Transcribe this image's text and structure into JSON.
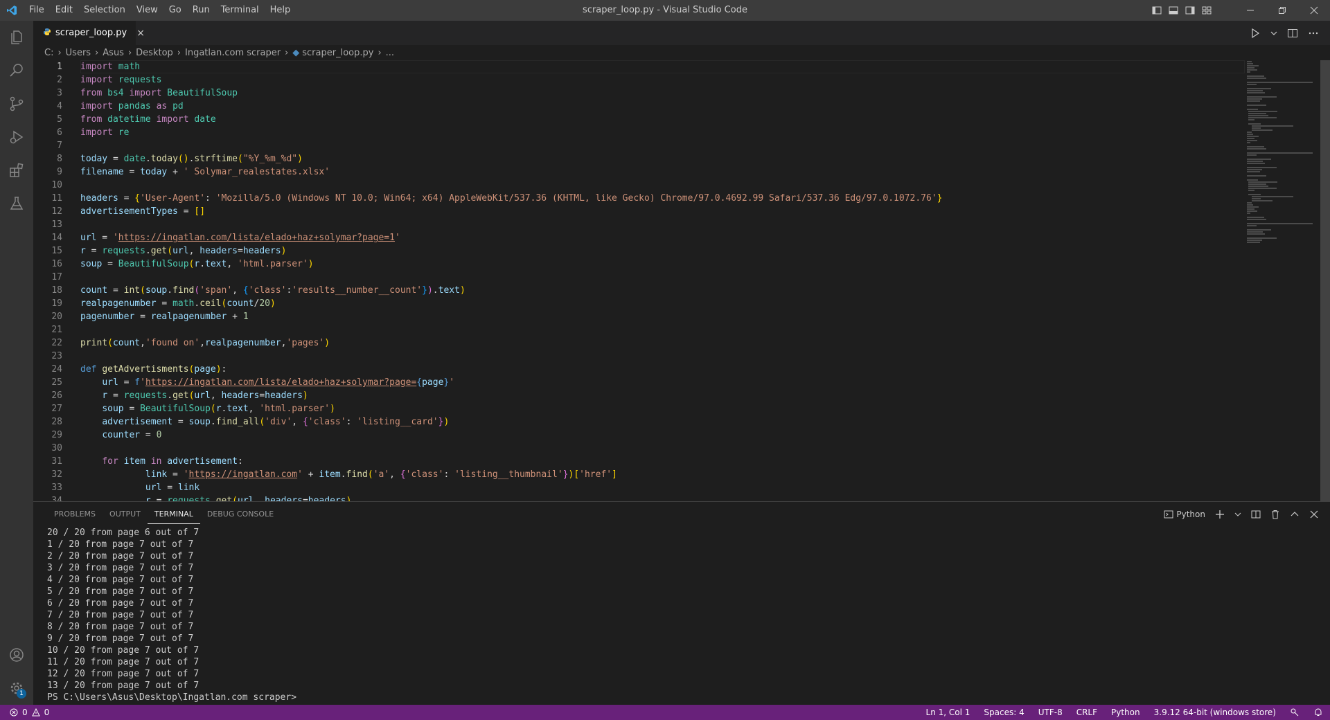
{
  "window": {
    "title": "scraper_loop.py - Visual Studio Code",
    "menu": [
      "File",
      "Edit",
      "Selection",
      "View",
      "Go",
      "Run",
      "Terminal",
      "Help"
    ]
  },
  "tab": {
    "label": "scraper_loop.py",
    "close_glyph": "×"
  },
  "breadcrumb": [
    "C:",
    "Users",
    "Asus",
    "Desktop",
    "Ingatlan.com scraper",
    "scraper_loop.py",
    "..."
  ],
  "code_lines": [
    "import math",
    "import requests",
    "from bs4 import BeautifulSoup",
    "import pandas as pd",
    "from datetime import date",
    "import re",
    "",
    "today = date.today().strftime(\"%Y_%m_%d\")",
    "filename = today + ' Solymar_realestates.xlsx'",
    "",
    "headers = {'User-Agent': 'Mozilla/5.0 (Windows NT 10.0; Win64; x64) AppleWebKit/537.36 (KHTML, like Gecko) Chrome/97.0.4692.99 Safari/537.36 Edg/97.0.1072.76'}",
    "advertisementTypes = []",
    "",
    "url = 'https://ingatlan.com/lista/elado+haz+solymar?page=1'",
    "r = requests.get(url, headers=headers)",
    "soup = BeautifulSoup(r.text, 'html.parser')",
    "",
    "count = int(soup.find('span', {'class':'results__number__count'}).text)",
    "realpagenumber = math.ceil(count/20)",
    "pagenumber = realpagenumber + 1",
    "",
    "print(count,'found on',realpagenumber,'pages')",
    "",
    "def getAdvertisments(page):",
    "    url = f'https://ingatlan.com/lista/elado+haz+solymar?page={page}'",
    "    r = requests.get(url, headers=headers)",
    "    soup = BeautifulSoup(r.text, 'html.parser')",
    "    advertisement = soup.find_all('div', {'class': 'listing__card'})",
    "    counter = 0",
    "",
    "    for item in advertisement:",
    "            link = 'https://ingatlan.com' + item.find('a', {'class': 'listing__thumbnail'})['href']",
    "            url = link",
    "            r = requests.get(url, headers=headers)"
  ],
  "panel": {
    "tabs": [
      "PROBLEMS",
      "OUTPUT",
      "TERMINAL",
      "DEBUG CONSOLE"
    ],
    "active_tab": "TERMINAL",
    "shell_label": "Python",
    "terminal_lines": [
      "20 / 20 from page 6 out of 7",
      "1 / 20 from page 7 out of 7",
      "2 / 20 from page 7 out of 7",
      "3 / 20 from page 7 out of 7",
      "4 / 20 from page 7 out of 7",
      "5 / 20 from page 7 out of 7",
      "6 / 20 from page 7 out of 7",
      "7 / 20 from page 7 out of 7",
      "8 / 20 from page 7 out of 7",
      "9 / 20 from page 7 out of 7",
      "10 / 20 from page 7 out of 7",
      "11 / 20 from page 7 out of 7",
      "12 / 20 from page 7 out of 7",
      "13 / 20 from page 7 out of 7",
      "PS C:\\Users\\Asus\\Desktop\\Ingatlan.com scraper>"
    ]
  },
  "statusbar": {
    "errors": "0",
    "warnings": "0",
    "position": "Ln 1, Col 1",
    "spaces": "Spaces: 4",
    "encoding": "UTF-8",
    "eol": "CRLF",
    "language": "Python",
    "interpreter": "3.9.12 64-bit (windows store)"
  },
  "activity": {
    "badge_count": "1"
  },
  "colors": {
    "statusbar": "#68217a",
    "titlebar": "#3c3c3c",
    "activitybar": "#333333",
    "editor": "#1e1e1e",
    "accent": "#0078d4"
  }
}
